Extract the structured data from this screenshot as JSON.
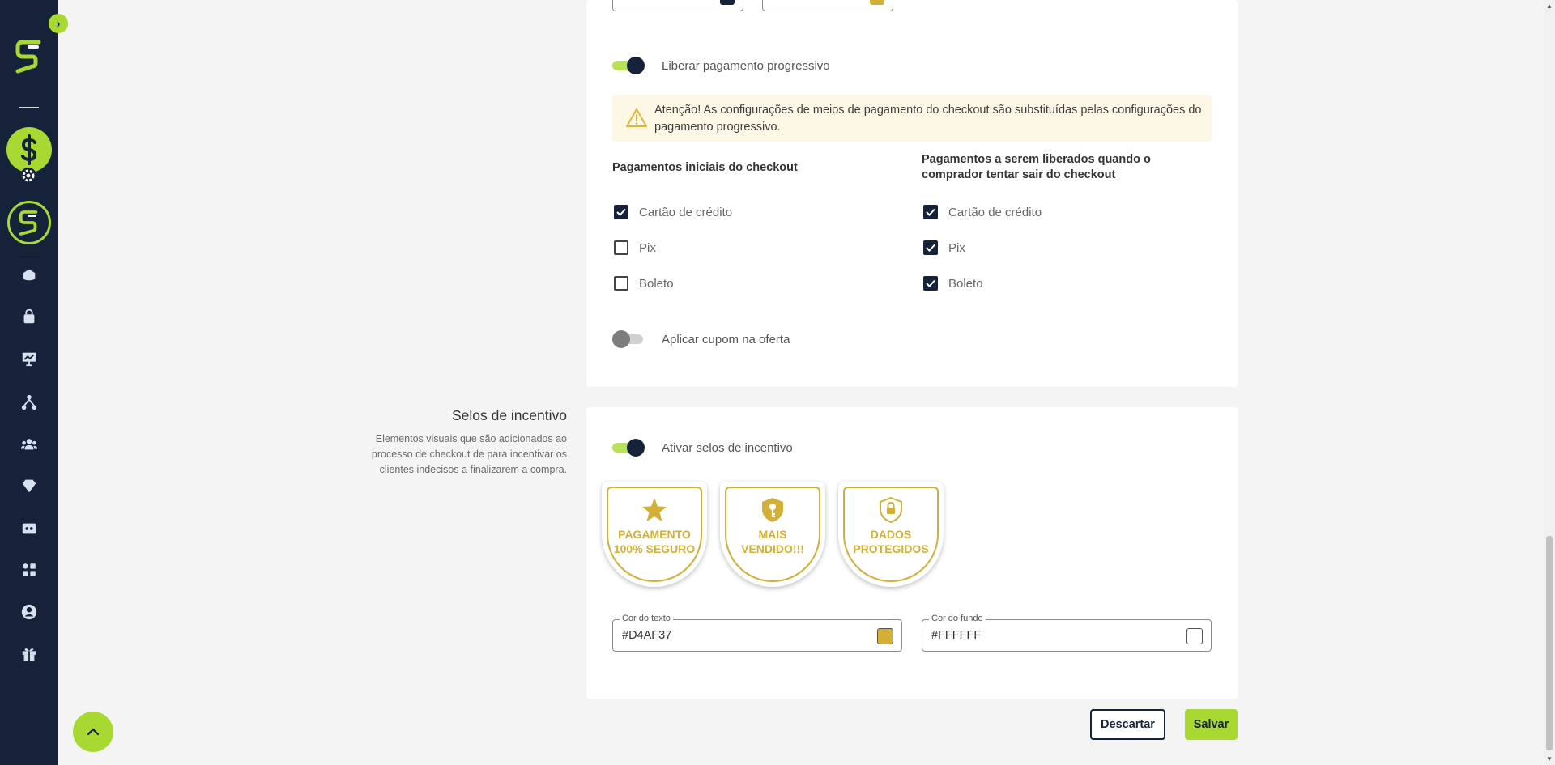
{
  "progressive_payment": {
    "toggle_label": "Liberar pagamento progressivo",
    "toggle_on": true,
    "alert_text": "Atenção! As configurações de meios de pagamento do checkout são substituídas pelas configurações do pagamento progressivo.",
    "initial_title": "Pagamentos iniciais do checkout",
    "release_title": "Pagamentos a serem liberados quando o comprador tentar sair do checkout",
    "initial_methods": [
      {
        "label": "Cartão de crédito",
        "checked": true
      },
      {
        "label": "Pix",
        "checked": false
      },
      {
        "label": "Boleto",
        "checked": false
      }
    ],
    "release_methods": [
      {
        "label": "Cartão de crédito",
        "checked": true
      },
      {
        "label": "Pix",
        "checked": true
      },
      {
        "label": "Boleto",
        "checked": true
      }
    ]
  },
  "coupon": {
    "toggle_label": "Aplicar cupom na oferta",
    "toggle_on": false
  },
  "incentive_seals": {
    "section_title": "Selos de incentivo",
    "section_description": "Elementos visuais que são adicionados ao processo de checkout de para incentivar os clientes indecisos a finalizarem a compra.",
    "toggle_label": "Ativar selos de incentivo",
    "toggle_on": true,
    "badges": [
      {
        "icon": "star-icon",
        "line1": "PAGAMENTO",
        "line2": "100% SEGURO"
      },
      {
        "icon": "key-shield-icon",
        "line1": "MAIS",
        "line2": "VENDIDO!!!"
      },
      {
        "icon": "lock-shield-icon",
        "line1": "DADOS",
        "line2": "PROTEGIDOS"
      }
    ],
    "text_color": {
      "label": "Cor do texto",
      "value": "#D4AF37"
    },
    "background_color": {
      "label": "Cor do fundo",
      "value": "#FFFFFF"
    }
  },
  "top_swatches": {
    "left_color": "#16213a",
    "right_color": "#d4af37"
  },
  "colors": {
    "accent": "#a8d932",
    "sidebar": "#16213a",
    "gold": "#d4af37"
  },
  "actions": {
    "discard_label": "Descartar",
    "save_label": "Salvar"
  }
}
